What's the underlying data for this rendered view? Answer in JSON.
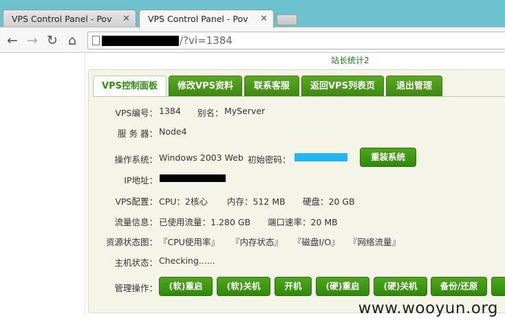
{
  "browser": {
    "tabs": [
      {
        "title": "VPS Control Panel - Pov",
        "active": false
      },
      {
        "title": "VPS Control Panel - Pov",
        "active": true
      }
    ],
    "url": "/?vi=1384"
  },
  "header": {
    "stat_link": "站长统计2"
  },
  "nav_tabs": [
    {
      "label": "VPS控制面板",
      "active": true
    },
    {
      "label": "修改VPS资料",
      "active": false
    },
    {
      "label": "联系客服",
      "active": false
    },
    {
      "label": "返回VPS列表页",
      "active": false
    },
    {
      "label": "退出管理",
      "active": false
    }
  ],
  "info": {
    "vps_id_label": "VPS编号：",
    "vps_id": "1384",
    "alias_label": "别名：",
    "alias": "MyServer",
    "server_label": "服 务 器：",
    "server": "Node4",
    "os_label": "操作系统：",
    "os": "Windows 2003 Web",
    "init_pwd_label": "初始密码：",
    "reinstall_button": "重装系统",
    "ip_label": "IP地址：",
    "config_label": "VPS配置：",
    "cpu": "CPU：2核心",
    "memory": "内存：512 MB",
    "disk": "硬盘：20 GB",
    "traffic_label": "流量信息：",
    "traffic_used": "已使用流量：1.280 GB",
    "port_speed": "端口速率：20 MB",
    "charts_label": "资源状态图：",
    "charts": [
      "『CPU使用率』",
      "『内存状态』",
      "『磁盘I/O』",
      "『网络流量』"
    ],
    "host_status_label": "主机状态：",
    "host_status": "Checking......",
    "manage_label": "管理操作："
  },
  "actions": [
    "(软)重启",
    "(软)关机",
    "开机",
    "(硬)重启",
    "(硬)关机",
    "备份/还原"
  ],
  "watermark": "www.wooyun.org"
}
